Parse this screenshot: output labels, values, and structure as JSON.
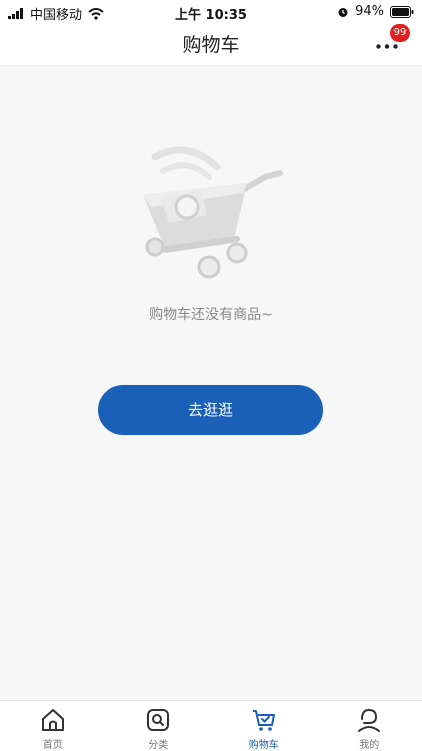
{
  "status_bar": {
    "carrier": "中国移动",
    "time": "上午 10:35",
    "battery": "94%",
    "icons": [
      "signal-icon",
      "wifi-icon",
      "alarm-icon",
      "battery-icon"
    ]
  },
  "nav": {
    "title": "购物车",
    "more_badge": "99",
    "more_icon": "more-dots-icon"
  },
  "empty_state": {
    "icon": "empty-cart-icon",
    "text": "购物车还没有商品~",
    "button_label": "去逛逛"
  },
  "tabbar": {
    "items": [
      {
        "label": "首页",
        "icon": "home-icon",
        "active": false
      },
      {
        "label": "分类",
        "icon": "category-search-icon",
        "active": false
      },
      {
        "label": "购物车",
        "icon": "cart-icon",
        "active": true
      },
      {
        "label": "我的",
        "icon": "profile-icon",
        "active": false
      }
    ]
  },
  "colors": {
    "primary": "#1a5fb8",
    "badge": "#e02020",
    "background": "#f7f7f7"
  }
}
